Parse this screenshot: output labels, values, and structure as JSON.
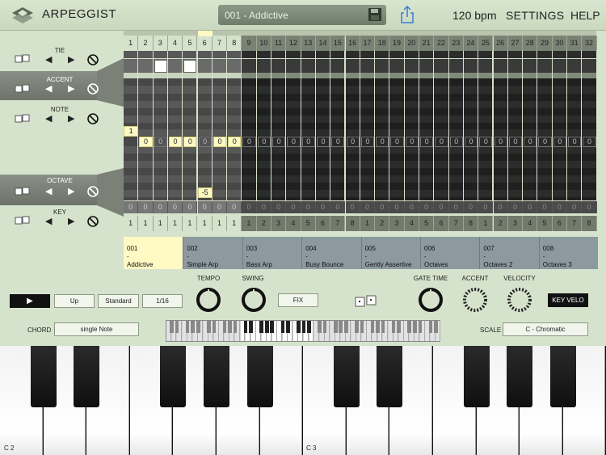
{
  "header": {
    "app_title": "ARPEGGIST",
    "preset_name": "001 - Addictive",
    "bpm": "120 bpm",
    "settings_label": "SETTINGS",
    "help_label": "HELP"
  },
  "lanes": {
    "tie": "TIE",
    "accent": "ACCENT",
    "note": "NOTE",
    "octave": "OCTAVE",
    "key": "KEY"
  },
  "steps": [
    "1",
    "2",
    "3",
    "4",
    "5",
    "6",
    "7",
    "8",
    "9",
    "10",
    "11",
    "12",
    "13",
    "14",
    "15",
    "16",
    "17",
    "18",
    "19",
    "20",
    "21",
    "22",
    "23",
    "24",
    "25",
    "26",
    "27",
    "28",
    "29",
    "30",
    "31",
    "32"
  ],
  "zero_row": [
    "0",
    "0",
    "0",
    "0",
    "0",
    "0",
    "0",
    "0",
    "0",
    "0",
    "0",
    "0",
    "0",
    "0",
    "0",
    "0",
    "0",
    "0",
    "0",
    "0",
    "0",
    "0",
    "0",
    "0",
    "0",
    "0",
    "0",
    "0",
    "0",
    "0",
    "0",
    "0"
  ],
  "bottom_numbers": [
    "1",
    "1",
    "1",
    "1",
    "1",
    "1",
    "1",
    "1",
    "1",
    "2",
    "3",
    "4",
    "5",
    "6",
    "7",
    "8",
    "1",
    "2",
    "3",
    "4",
    "5",
    "6",
    "7",
    "8",
    "1",
    "2",
    "3",
    "4",
    "5",
    "6",
    "7",
    "8"
  ],
  "note_values": {
    "step1": "1",
    "row_zero_label": "0",
    "octave_step6": "-5"
  },
  "presets": [
    {
      "num": "001",
      "dash": "-",
      "name": "Addictive"
    },
    {
      "num": "002",
      "dash": "-",
      "name": "Simple Arp"
    },
    {
      "num": "003",
      "dash": "-",
      "name": "Bass Arp"
    },
    {
      "num": "004",
      "dash": "-",
      "name": "Busy Bounce"
    },
    {
      "num": "005",
      "dash": "-",
      "name": "Gently Assertive"
    },
    {
      "num": "006",
      "dash": "-",
      "name": "Octaves"
    },
    {
      "num": "007",
      "dash": "-",
      "name": "Octaves 2"
    },
    {
      "num": "008",
      "dash": "-",
      "name": "Octaves 3"
    }
  ],
  "controls": {
    "direction": "Up",
    "mode": "Standard",
    "rate": "1/16",
    "tempo_label": "TEMPO",
    "swing_label": "SWING",
    "fix_label": "FIX",
    "gate_label": "GATE TIME",
    "accent_label": "ACCENT",
    "velocity_label": "VELOCITY",
    "key_velo": "KEY VELO",
    "chord_label": "CHORD",
    "chord_value": "single Note",
    "scale_label": "SCALE",
    "scale_value": "C - Chromatic"
  },
  "keyboard": {
    "label_c2": "C 2",
    "label_c3": "C 3"
  },
  "colors": {
    "background": "#d6e3cc",
    "highlight": "#fff9c4",
    "grid_dark": "#2b2b2b",
    "grid_light": "#555555",
    "preset_normal": "#8c9aa0"
  }
}
